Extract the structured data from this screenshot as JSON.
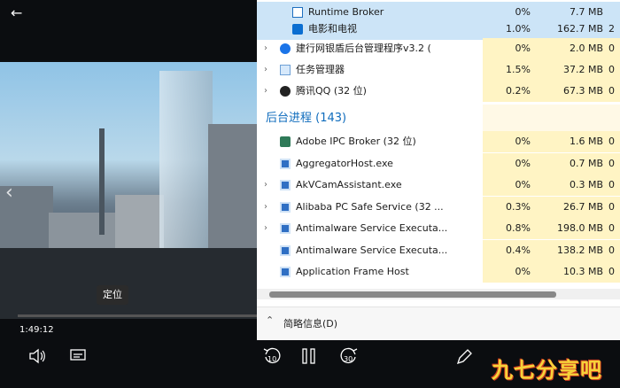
{
  "player": {
    "tooltip": "定位",
    "current_time": "1:49:12",
    "progress": 0.0,
    "icons": [
      "back-arrow-icon",
      "chevron-left-icon",
      "volume-icon",
      "subtitles-icon",
      "rewind-10-icon",
      "pause-icon",
      "forward-30-icon",
      "pen-icon"
    ],
    "rewind_label": "10",
    "forward_label": "30"
  },
  "task_manager": {
    "rows": [
      {
        "name": "Runtime Broker",
        "cpu": "0%",
        "mem": "7.7 MB",
        "extra": "",
        "icon": "runtime-icon",
        "selected": true,
        "expand": false
      },
      {
        "name": "电影和电视",
        "cpu": "1.0%",
        "mem": "162.7 MB",
        "extra": "2",
        "icon": "movies-tv-icon",
        "selected": true,
        "expand": false
      },
      {
        "name": "建行网银盾后台管理程序v3.2 (",
        "cpu": "0%",
        "mem": "2.0 MB",
        "extra": "0",
        "icon": "ccb-icon",
        "selected": false,
        "expand": true
      },
      {
        "name": "任务管理器",
        "cpu": "1.5%",
        "mem": "37.2 MB",
        "extra": "0",
        "icon": "task-manager-icon",
        "selected": false,
        "expand": true
      },
      {
        "name": "腾讯QQ (32 位)",
        "cpu": "0.2%",
        "mem": "67.3 MB",
        "extra": "0",
        "icon": "qq-icon",
        "selected": false,
        "expand": true
      }
    ],
    "group_title": "后台进程 (143)",
    "bg_rows": [
      {
        "name": "Adobe IPC Broker (32 位)",
        "cpu": "0%",
        "mem": "1.6 MB",
        "extra": "0",
        "icon": "adobe-icon",
        "expand": false
      },
      {
        "name": "AggregatorHost.exe",
        "cpu": "0%",
        "mem": "0.7 MB",
        "extra": "0",
        "icon": "app-icon",
        "expand": false
      },
      {
        "name": "AkVCamAssistant.exe",
        "cpu": "0%",
        "mem": "0.3 MB",
        "extra": "0",
        "icon": "app-icon",
        "expand": true
      },
      {
        "name": "Alibaba PC Safe Service (32 ...",
        "cpu": "0.3%",
        "mem": "26.7 MB",
        "extra": "0",
        "icon": "app-icon",
        "expand": true
      },
      {
        "name": "Antimalware Service Executa...",
        "cpu": "0.8%",
        "mem": "198.0 MB",
        "extra": "0",
        "icon": "app-icon",
        "expand": true
      },
      {
        "name": "Antimalware Service Executa...",
        "cpu": "0.4%",
        "mem": "138.2 MB",
        "extra": "0",
        "icon": "app-icon",
        "expand": false
      },
      {
        "name": "Application Frame Host",
        "cpu": "0%",
        "mem": "10.3 MB",
        "extra": "0",
        "icon": "app-icon",
        "expand": false
      }
    ],
    "footer_label": "简略信息(D)"
  },
  "watermark": "九七分享吧"
}
